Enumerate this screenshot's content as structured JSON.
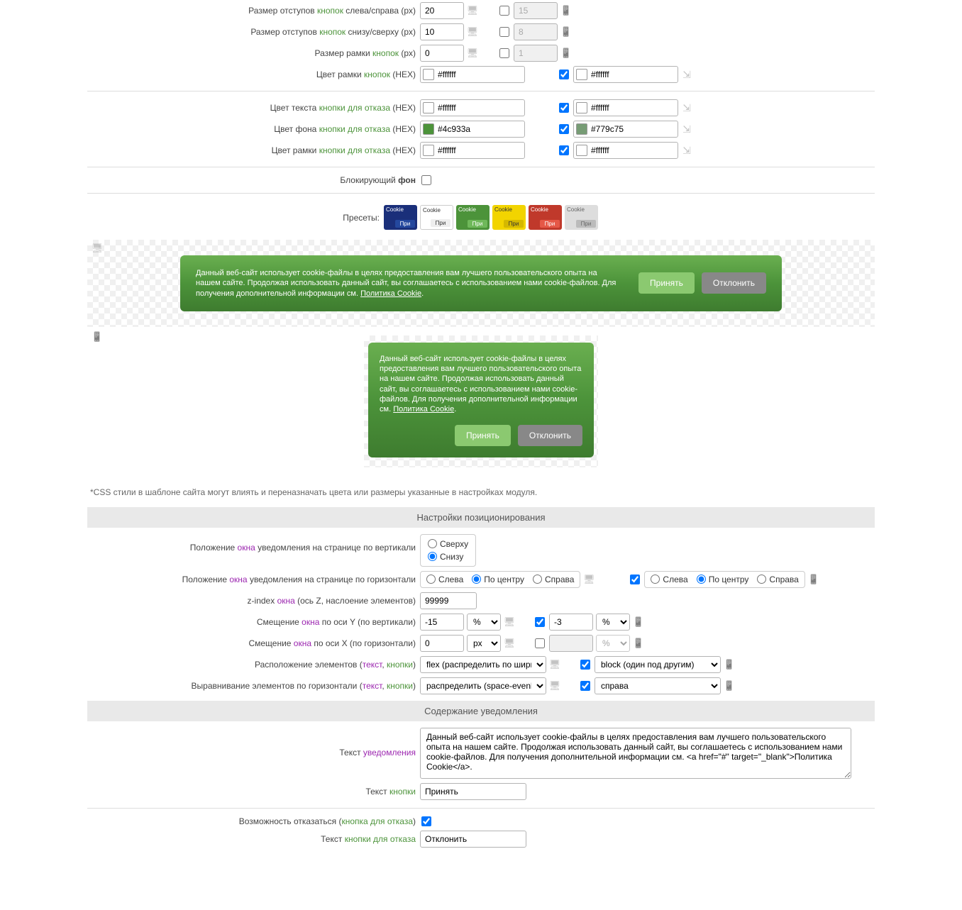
{
  "rows": {
    "padding_lr": {
      "label_pre": "Размер отступов ",
      "label_green": "кнопок",
      "label_post": " слева/справа (px)",
      "val": "20",
      "val2": "15"
    },
    "padding_tb": {
      "label_pre": "Размер отступов ",
      "label_green": "кнопок",
      "label_post": " снизу/сверху (px)",
      "val": "10",
      "val2": "8"
    },
    "border_size": {
      "label_pre": "Размер рамки ",
      "label_green": "кнопок",
      "label_post": " (px)",
      "val": "0",
      "val2": "1"
    },
    "border_color": {
      "label_pre": "Цвет рамки ",
      "label_green": "кнопок",
      "label_post": " (HEX)",
      "val": "#ffffff",
      "val2": "#ffffff"
    },
    "decline_text": {
      "label_pre": "Цвет текста ",
      "label_green": "кнопки для отказа",
      "label_post": " (HEX)",
      "val": "#ffffff",
      "val2": "#ffffff"
    },
    "decline_bg": {
      "label_pre": "Цвет фона ",
      "label_green": "кнопки для отказа",
      "label_post": " (HEX)",
      "val": "#4c933a",
      "val2": "#779c75"
    },
    "decline_border": {
      "label_pre": "Цвет рамки ",
      "label_green": "кнопки для отказа",
      "label_post": " (HEX)",
      "val": "#ffffff",
      "val2": "#ffffff"
    },
    "blocking_bg": {
      "label_pre": "Блокирующий ",
      "label_green": "фон",
      "label_post": ""
    }
  },
  "presets_label": "Пресеты:",
  "preset_text": "Cookie",
  "preset_btn": "При",
  "cookie_text": "Данный веб-сайт использует cookie-файлы в целях предоставления вам лучшего пользовательского опыта на нашем сайте. Продолжая использовать данный сайт, вы соглашаетесь с использованием нами cookie-файлов. Для получения дополнительной информации см. ",
  "cookie_link": "Политика Cookie",
  "btn_accept": "Принять",
  "btn_decline": "Отклонить",
  "note": "*CSS стили в шаблоне сайта могут влиять и переназначать цвета или размеры указанные в настройках модуля.",
  "section_positioning": "Настройки позиционирования",
  "pos": {
    "vertical_label_pre": "Положение ",
    "vertical_label_purple": "окна",
    "vertical_label_post": " уведомления на странице по вертикали",
    "top": "Сверху",
    "bottom": "Снизу",
    "horizontal_label_pre": "Положение ",
    "horizontal_label_purple": "окна",
    "horizontal_label_post": " уведомления на странице по горизонтали",
    "left": "Слева",
    "center": "По центру",
    "right": "Справа",
    "zindex_label_pre": "z-index ",
    "zindex_label_purple": "окна",
    "zindex_label_post": " (ось Z, наслоение элементов)",
    "zindex_val": "99999",
    "offy_label_pre": "Смещение ",
    "offy_label_purple": "окна",
    "offy_label_post": " по оси Y (по вертикали)",
    "offy_val": "-15",
    "offy_unit": "%",
    "offy_val2": "-3",
    "offy_unit2": "%",
    "offx_label_pre": "Смещение ",
    "offx_label_purple": "окна",
    "offx_label_post": " по оси X (по горизонтали)",
    "offx_val": "0",
    "offx_unit": "px",
    "offx_val2": "",
    "offx_unit2": "%",
    "layout_label_pre": "Расположение элементов (",
    "layout_label_purple": "текст",
    "layout_label_comma": ", ",
    "layout_label_green": "кнопки",
    "layout_label_post": ")",
    "layout_val": "flex (распределить по ширине)",
    "layout_val2": "block (один под другим)",
    "align_label_pre": "Выравнивание элементов по горизонтали (",
    "align_label_purple": "текст",
    "align_label_comma": ", ",
    "align_label_green": "кнопки",
    "align_label_post": ")",
    "align_val": "распределить (space-evenly)",
    "align_val2": "справа"
  },
  "section_content": "Содержание уведомления",
  "content": {
    "text_label_pre": "Текст ",
    "text_label_purple": "уведомления",
    "text_val": "Данный веб-сайт использует cookie-файлы в целях предоставления вам лучшего пользовательского опыта на нашем сайте. Продолжая использовать данный сайт, вы соглашаетесь с использованием нами cookie-файлов. Для получения дополнительной информации см. <a href=\"#\" target=\"_blank\">Политика Cookie</a>.",
    "btn_label_pre": "Текст ",
    "btn_label_green": "кнопки",
    "btn_val": "Принять",
    "decline_opt_pre": "Возможность отказаться (",
    "decline_opt_green": "кнопка для отказа",
    "decline_opt_post": ")",
    "decline_btn_label_pre": "Текст ",
    "decline_btn_label_green": "кнопки для отказа",
    "decline_btn_val": "Отклонить"
  }
}
